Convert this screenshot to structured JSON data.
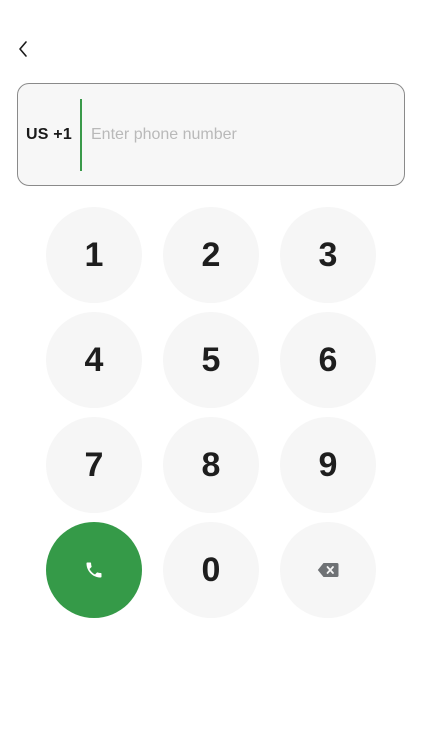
{
  "header": {
    "back_icon": "chevron-left-icon"
  },
  "phone_input": {
    "country_code": "US +1",
    "placeholder": "Enter phone number",
    "value": ""
  },
  "keypad": {
    "keys": [
      "1",
      "2",
      "3",
      "4",
      "5",
      "6",
      "7",
      "8",
      "9",
      "0"
    ],
    "call_icon": "phone-icon",
    "backspace_icon": "backspace-icon"
  },
  "colors": {
    "accent": "#359a48",
    "key_background": "#f6f6f6",
    "placeholder": "#b9b9b9"
  }
}
